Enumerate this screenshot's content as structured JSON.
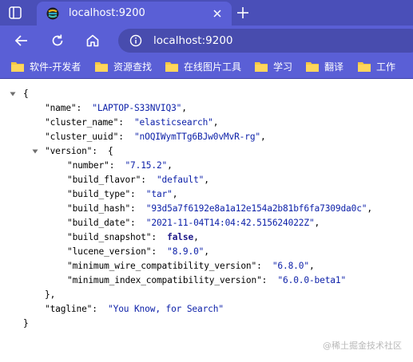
{
  "browser": {
    "tab_title": "localhost:9200",
    "url": "localhost:9200",
    "bookmarks": [
      "软件-开发者",
      "资源查找",
      "在线图片工具",
      "学习",
      "翻译",
      "工作"
    ]
  },
  "json_view": {
    "open_brace": "{",
    "close_brace": "}",
    "name_key": "\"name\"",
    "name_val": "\"LAPTOP-S33NVIQ3\"",
    "cluster_name_key": "\"cluster_name\"",
    "cluster_name_val": "\"elasticsearch\"",
    "cluster_uuid_key": "\"cluster_uuid\"",
    "cluster_uuid_val": "\"nOQIWymTTg6BJw0vMvR-rg\"",
    "version_key": "\"version\"",
    "version_open": "{",
    "version_close": "},",
    "number_key": "\"number\"",
    "number_val": "\"7.15.2\"",
    "build_flavor_key": "\"build_flavor\"",
    "build_flavor_val": "\"default\"",
    "build_type_key": "\"build_type\"",
    "build_type_val": "\"tar\"",
    "build_hash_key": "\"build_hash\"",
    "build_hash_val": "\"93d5a7f6192e8a1a12e154a2b81bf6fa7309da0c\"",
    "build_date_key": "\"build_date\"",
    "build_date_val": "\"2021-11-04T14:04:42.515624022Z\"",
    "build_snapshot_key": "\"build_snapshot\"",
    "build_snapshot_val": "false",
    "lucene_version_key": "\"lucene_version\"",
    "lucene_version_val": "\"8.9.0\"",
    "min_wire_key": "\"minimum_wire_compatibility_version\"",
    "min_wire_val": "\"6.8.0\"",
    "min_index_key": "\"minimum_index_compatibility_version\"",
    "min_index_val": "\"6.0.0-beta1\"",
    "tagline_key": "\"tagline\"",
    "tagline_val": "\"You Know, for Search\""
  },
  "watermark": "@稀土掘金技术社区",
  "colors": {
    "chrome_dark": "#4a4fb8",
    "chrome": "#5a5fd6",
    "string": "#0b1fa8",
    "keyword": "#1f1a8a"
  }
}
